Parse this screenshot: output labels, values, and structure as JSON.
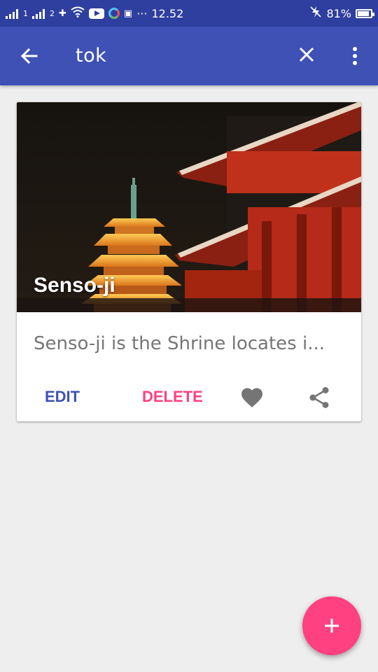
{
  "status_bar": {
    "sim1": "1",
    "sim2": "2",
    "overflow": "···",
    "time": "12.52",
    "battery": "81%"
  },
  "app_bar": {
    "search_query": "tok",
    "icons": [
      "arrow-back-icon",
      "close-icon",
      "more-vert-icon"
    ]
  },
  "card": {
    "title": "Senso-ji",
    "description": "Senso-ji is the Shrine locates i...",
    "edit_label": "EDIT",
    "delete_label": "DELETE",
    "icons": [
      "heart-icon",
      "share-icon"
    ]
  },
  "fab": {
    "icon": "add-icon"
  },
  "colors": {
    "primary": "#3f51b5",
    "primary_dark": "#2f3f9f",
    "accent": "#ff4081",
    "background": "#eeeeee"
  }
}
